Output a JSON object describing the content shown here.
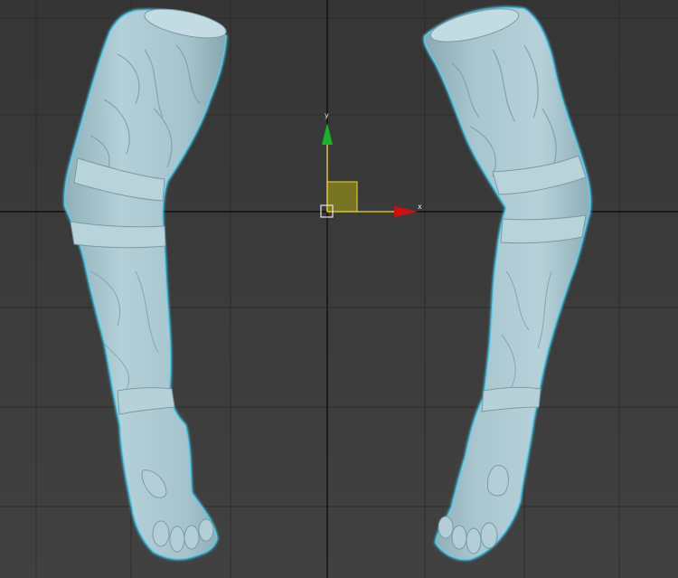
{
  "viewport": {
    "background": "#3b3b3b",
    "grid_color": "#2a2a2a",
    "axis_color": "#111111"
  },
  "model": {
    "skin_color": "#a9c6cf",
    "shadow_color": "#7f9ea8",
    "selection_outline": "#4fc9ec",
    "objects": [
      "left-arm-mesh",
      "right-arm-mesh"
    ]
  },
  "gizmo": {
    "x_label": "x",
    "y_label": "y",
    "x_color": "#d01010",
    "y_color": "#15b52b",
    "plane_color": "#a4a020",
    "axis_line_color": "#d8c32a"
  }
}
